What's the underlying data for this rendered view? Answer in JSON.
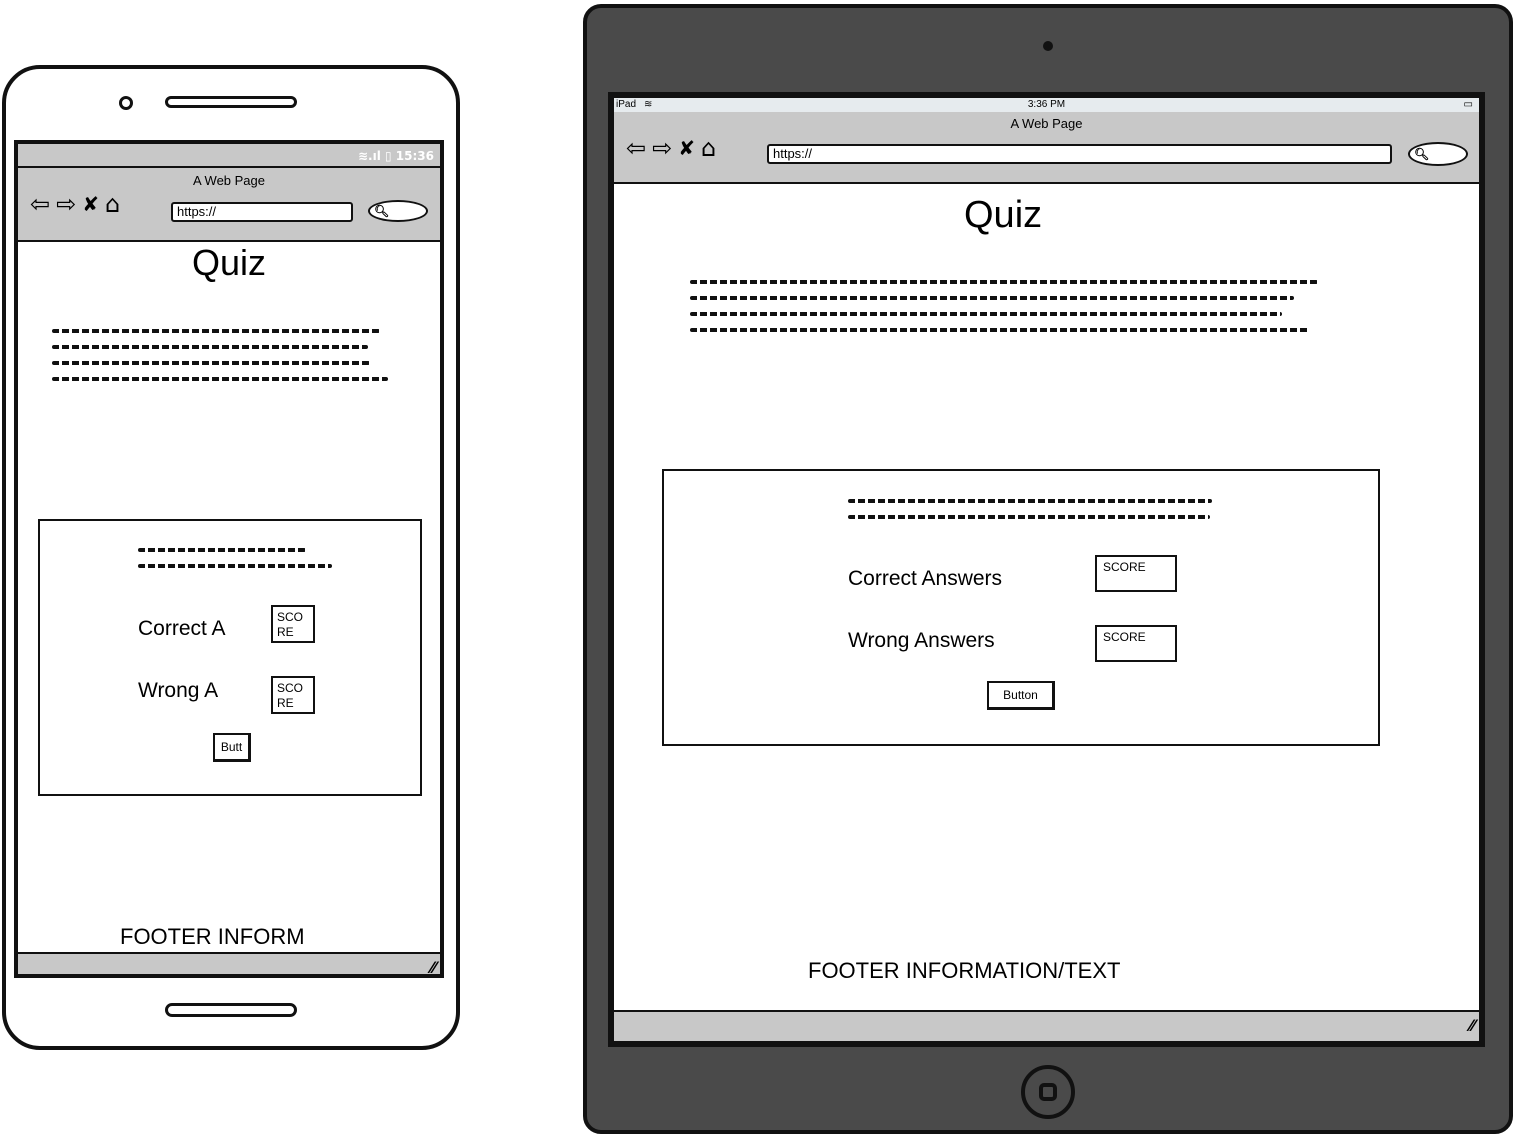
{
  "phone": {
    "status_time": "15:36",
    "browser": {
      "title": "A Web Page",
      "url": "https://"
    },
    "heading": "Quiz",
    "question": {
      "correct_label": "Correct A",
      "wrong_label": "Wrong A",
      "score_label": "SCO\nRE",
      "button_label": "Butt"
    },
    "footer": "FOOTER INFORM"
  },
  "tablet": {
    "status": {
      "carrier": "iPad",
      "time": "3:36 PM"
    },
    "browser": {
      "title": "A Web Page",
      "url": "https://"
    },
    "heading": "Quiz",
    "question": {
      "correct_label": "Correct Answers",
      "wrong_label": "Wrong Answers",
      "score_label": "SCORE",
      "button_label": "Button"
    },
    "footer": "FOOTER INFORMATION/TEXT"
  },
  "icons": [
    "back-arrow-icon",
    "forward-arrow-icon",
    "close-icon",
    "home-icon",
    "search-icon",
    "wifi-icon",
    "battery-icon",
    "resize-grip-icon",
    "camera-icon",
    "home-button-icon"
  ],
  "colors": {
    "bezel": "#4a4a4a",
    "chrome": "#c8c8c8",
    "ink": "#111111"
  }
}
